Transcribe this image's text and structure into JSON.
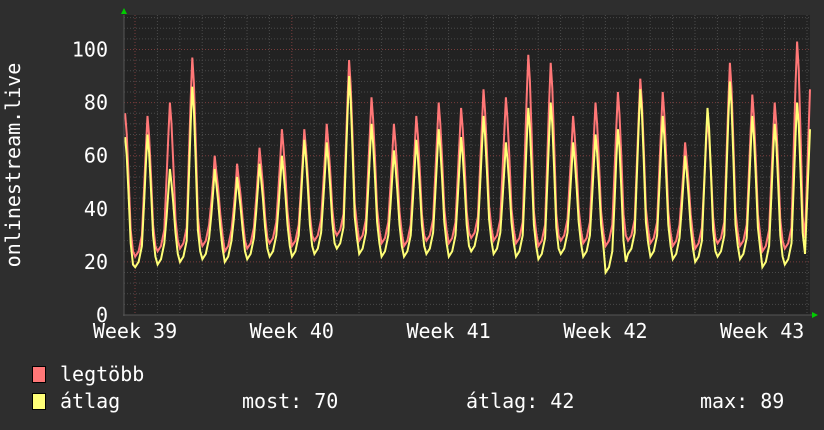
{
  "chart_data": {
    "type": "line",
    "ylabel": "onlinestream.live",
    "ylim": [
      0,
      113
    ],
    "yticks": [
      0,
      20,
      40,
      60,
      80,
      100
    ],
    "xticks": [
      "Week 39",
      "Week 40",
      "Week 41",
      "Week 42",
      "Week 43"
    ],
    "grid": true,
    "days": 31,
    "series": [
      {
        "name": "legtöbb",
        "color": "#ff7777",
        "daily_peaks": [
          76,
          75,
          80,
          97,
          60,
          57,
          63,
          70,
          70,
          72,
          96,
          82,
          72,
          75,
          80,
          78,
          85,
          82,
          98,
          95,
          75,
          80,
          84,
          89,
          84,
          65,
          75,
          95,
          83,
          80,
          103
        ],
        "daily_troughs": [
          20,
          22,
          24,
          25,
          26,
          24,
          25,
          27,
          26,
          28,
          30,
          28,
          27,
          26,
          28,
          27,
          29,
          28,
          27,
          26,
          28,
          27,
          26,
          28,
          27,
          26,
          25,
          27,
          26,
          24,
          25
        ],
        "last": 85
      },
      {
        "name": "átlag",
        "color": "#ffff77",
        "daily_peaks": [
          67,
          68,
          55,
          86,
          55,
          52,
          57,
          60,
          66,
          65,
          90,
          72,
          62,
          66,
          70,
          67,
          75,
          65,
          78,
          80,
          65,
          68,
          70,
          85,
          75,
          60,
          78,
          88,
          75,
          72,
          80
        ],
        "daily_troughs": [
          15,
          18,
          19,
          20,
          21,
          20,
          21,
          22,
          22,
          23,
          25,
          23,
          22,
          22,
          23,
          22,
          24,
          23,
          22,
          21,
          23,
          22,
          16,
          23,
          22,
          21,
          20,
          22,
          21,
          18,
          19
        ],
        "last": 70
      }
    ]
  },
  "legend": {
    "max_label": "legtöbb",
    "avg_label": "átlag",
    "now": "most: 70",
    "average": "átlag: 42",
    "max": "max: 89"
  }
}
